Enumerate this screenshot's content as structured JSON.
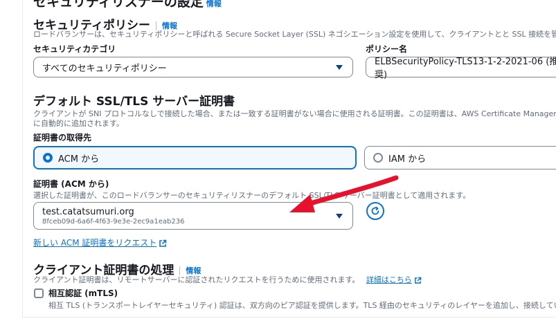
{
  "header": {
    "title": "セキュリティリスナーの設定",
    "info": "情報"
  },
  "security_policy": {
    "title": "セキュリティポリシー",
    "info": "情報",
    "description": "ロードバランサーは、セキュリティポリシーと呼ばれる Secure Socket Layer (SSL) ネゴシエーション設定を使用して、クライアントとと SSL 接続を管理しま",
    "category_label": "セキュリティカテゴリ",
    "category_value": "すべてのセキュリティポリシー",
    "policy_label": "ポリシー名",
    "policy_value": "ELBSecurityPolicy-TLS13-1-2-2021-06 (推奨)"
  },
  "default_cert": {
    "title": "デフォルト SSL/TLS サーバー証明書",
    "description_line1": "クライアントが SNI プロトコルなしで接続した場合、または一致する証明書がない場合に使用される証明書。この証明書は、AWS Certificate Manager (ACM",
    "description_line2": "に自動的に追加されます。",
    "source_label": "証明書の取得先",
    "option_acm": "ACM から",
    "option_iam": "IAM から",
    "cert_label": "証明書 (ACM から)",
    "cert_description": "選択した証明書が、このロードバランサーのセキュリティリスナーのデフォルト SSL/TLS サーバー証明書として適用されます。",
    "cert_domain": "test.catatsumuri.org",
    "cert_id": "8fceb09d-6a6f-4f63-9e3e-2ec9a1eab236",
    "request_link": "新しい ACM 証明書をリクエスト"
  },
  "client_cert": {
    "title": "クライアント証明書の処理",
    "info": "情報",
    "description": "クライアント証明書は、リモートサーバーに認証されたリクエストを行うために使用されます。",
    "details_link": "詳細はこちら",
    "mtls_label": "相互認証 (mTLS)",
    "mtls_description": "相互 TLS (トランスポートレイヤーセキュリティ) 認証は、双方向のピア認証を提供します。TLS 経由のセキュリティのレイヤーを追加し、接続している"
  },
  "colors": {
    "accent": "#0972d3",
    "arrow": "#e8112d",
    "text": "#16191f",
    "muted": "#5f6b7a"
  }
}
